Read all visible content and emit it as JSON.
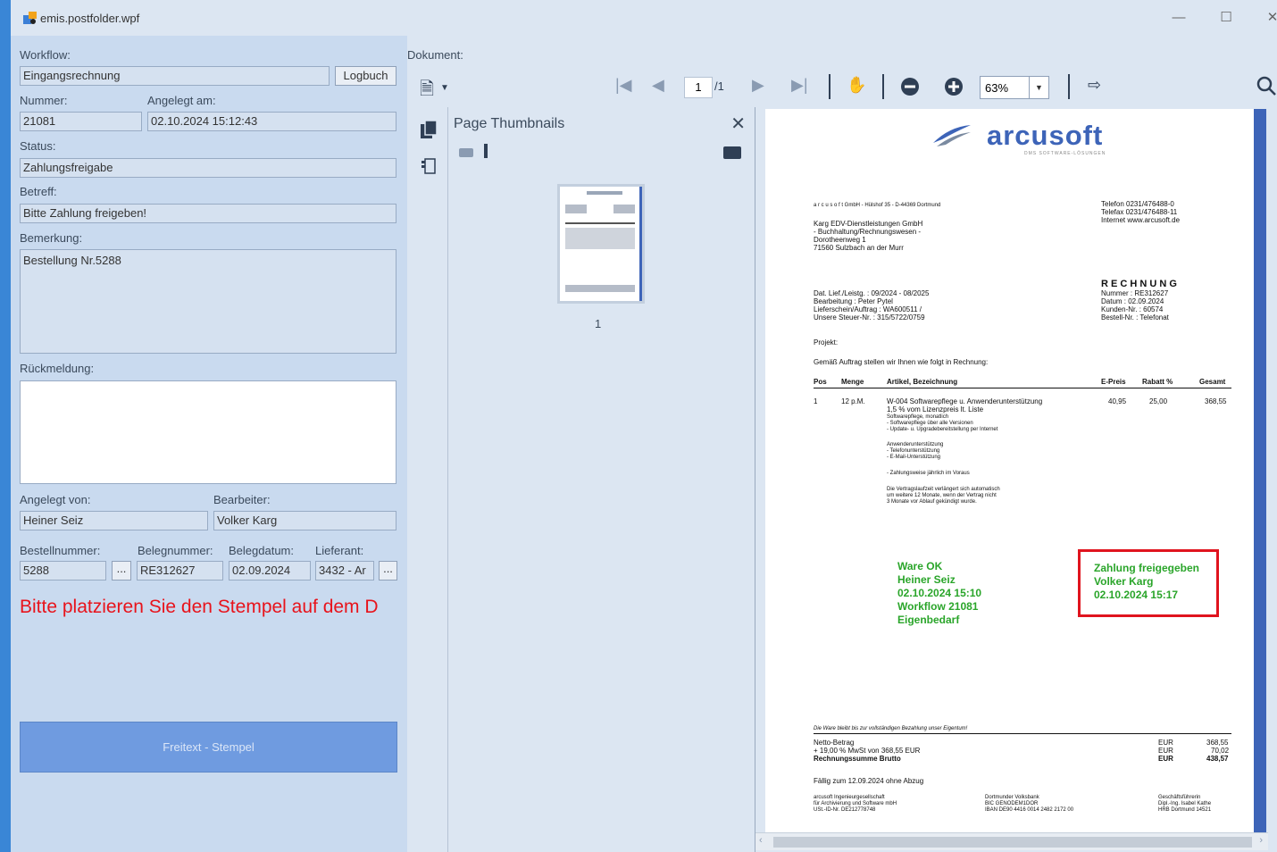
{
  "window": {
    "title": "emis.postfolder.wpf"
  },
  "form": {
    "workflow_label": "Workflow:",
    "workflow_value": "Eingangsrechnung",
    "logbuch_label": "Logbuch",
    "nummer_label": "Nummer:",
    "nummer_value": "21081",
    "angelegt_am_label": "Angelegt am:",
    "angelegt_am_value": "02.10.2024 15:12:43",
    "status_label": "Status:",
    "status_value": "Zahlungsfreigabe",
    "betreff_label": "Betreff:",
    "betreff_value": "Bitte Zahlung freigeben!",
    "bemerkung_label": "Bemerkung:",
    "bemerkung_value": "Bestellung Nr.5288",
    "rueckmeldung_label": "Rückmeldung:",
    "angelegt_von_label": "Angelegt von:",
    "angelegt_von_value": "Heiner Seiz",
    "bearbeiter_label": "Bearbeiter:",
    "bearbeiter_value": "Volker Karg",
    "bestellnummer_label": "Bestellnummer:",
    "bestellnummer_value": "5288",
    "belegnummer_label": "Belegnummer:",
    "belegnummer_value": "RE312627",
    "belegdatum_label": "Belegdatum:",
    "belegdatum_value": "02.09.2024",
    "lieferant_label": "Lieferant:",
    "lieferant_value": "3432 - Ar",
    "ellipsis": "...",
    "warning": "Bitte platzieren Sie den Stempel auf dem D",
    "stamp_button": "Freitext - Stempel"
  },
  "viewer": {
    "dokument_label": "Dokument:",
    "page_current": "1",
    "page_total": "/1",
    "zoom": "63%",
    "thumbs_title": "Page Thumbnails",
    "thumb_number": "1"
  },
  "doc": {
    "logo_text": "arcusoft",
    "logo_sub": "DMS SOFTWARE-LÖSUNGEN",
    "sender_line": "a r c u s o f t GmbH - Hülshof 35 - D-44369 Dortmund",
    "recipient": [
      "Karg EDV-Dienstleistungen GmbH",
      "- Buchhaltung/Rechnungswesen -",
      "Dorotheenweg 1",
      "71560 Sulzbach an der Murr"
    ],
    "contact": [
      "Telefon 0231/476488-0",
      "Telefax 0231/476488-11",
      "Internet www.arcusoft.de"
    ],
    "rechnung_title": "R E C H N U N G",
    "meta_left": [
      "Dat. Lief./Leistg.    :    09/2024 - 08/2025",
      "Bearbeitung           :    Peter Pytel",
      "Lieferschein/Auftrag :    WA600511  /",
      "Unsere Steuer-Nr.    :    315/5722/0759"
    ],
    "meta_right": [
      "Nummer       : RE312627",
      "Datum          : 02.09.2024",
      "Kunden-Nr.    : 60574",
      "Bestell-Nr.    : Telefonat"
    ],
    "projekt": "Projekt:",
    "intro": "Gemäß Auftrag stellen wir Ihnen wie folgt in Rechnung:",
    "col_pos": "Pos",
    "col_menge": "Menge",
    "col_artikel": "Artikel, Bezeichnung",
    "col_epreis": "E-Preis",
    "col_rabatt": "Rabatt %",
    "col_gesamt": "Gesamt",
    "row_pos": "1",
    "row_menge": "12  p.M.",
    "row_artikel": "W-004 Softwarepflege  u.  Anwenderunterstützung",
    "row_epreis": "40,95",
    "row_rabatt": "25,00",
    "row_gesamt": "368,55",
    "details": [
      "1,5 % vom Lizenzpreis lt. Liste",
      "Softwarepflege, monatlich",
      "- Softwarepflege über alle Versionen",
      "- Update- u. Upgradebereitstellung per Internet",
      "",
      "Anwenderunterstützung",
      "- Telefonunterstützung",
      "- E-Mail-Unterstützung",
      "",
      "- Zahlungsweise jährlich im Voraus",
      "",
      "Die Vertragslaufzeit verlängert sich automatisch",
      "um weitere 12 Monate, wenn der Vertrag nicht",
      "3 Monate vor Ablauf gekündigt wurde."
    ],
    "stamp1": [
      "Ware OK",
      "Heiner Seiz",
      "02.10.2024 15:10",
      "Workflow 21081",
      "Eigenbedarf"
    ],
    "stamp2": [
      "Zahlung freigegeben",
      "Volker Karg",
      "02.10.2024 15:17"
    ],
    "eigentum": "Die Ware bleibt bis zur vollständigen Bezahlung unser Eigentum!",
    "netto_label": "Netto-Betrag",
    "mwst_label": "+ 19,00 %  MwSt von 368,55  EUR",
    "brutto_label": "Rechnungssumme Brutto",
    "currency": [
      "EUR",
      "EUR",
      "EUR"
    ],
    "amounts": [
      "368,55",
      "70,02",
      "438,57"
    ],
    "faellig": "Fällig zum 12.09.2024 ohne Abzug",
    "footer_col1": [
      "arcusoft Ingenieurgesellschaft",
      "für Archivierung und Software mbH",
      "USt.-ID-Nr. DE212778748"
    ],
    "footer_col2": [
      "Dortmunder Volksbank",
      "BIC GENODEM1DOR",
      "IBAN DE90 4416 0014 2482 2172 00"
    ],
    "footer_col3": [
      "Geschäftsführerin",
      "Dipl.-Ing. Isabel Kathe",
      "HRB Dortmund 14521"
    ]
  },
  "colors": {
    "accent": "#3d64b8",
    "warning": "#e8131b",
    "stamp_green": "#2aa52a",
    "stamp_box": "#e0141e"
  }
}
